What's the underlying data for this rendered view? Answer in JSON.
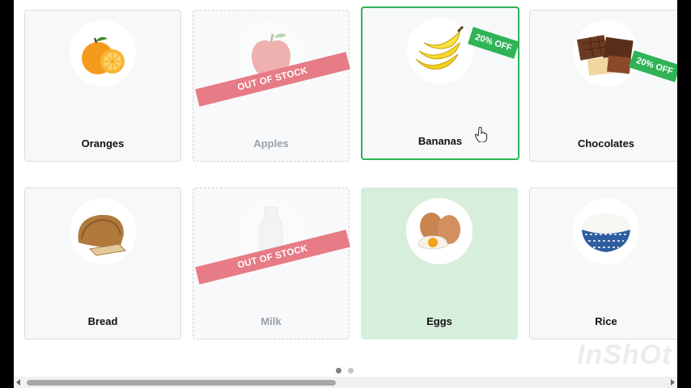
{
  "products": [
    {
      "name": "Oranges",
      "state": "normal"
    },
    {
      "name": "Apples",
      "state": "out_of_stock"
    },
    {
      "name": "Bananas",
      "state": "selected",
      "badge": "20% OFF"
    },
    {
      "name": "Chocolates",
      "state": "normal",
      "badge": "20% OFF"
    },
    {
      "name": "Bread",
      "state": "normal"
    },
    {
      "name": "Milk",
      "state": "out_of_stock"
    },
    {
      "name": "Eggs",
      "state": "tinted"
    },
    {
      "name": "Rice",
      "state": "normal"
    }
  ],
  "ribbon_text": "OUT OF STOCK",
  "pagination": {
    "count": 2,
    "active": 0
  },
  "watermark": "InShOt",
  "colors": {
    "discount_badge": "#2fb356",
    "out_of_stock_ribbon": "#e77b86",
    "selected_border": "#2fb356",
    "tinted_card": "#d8eedc"
  }
}
